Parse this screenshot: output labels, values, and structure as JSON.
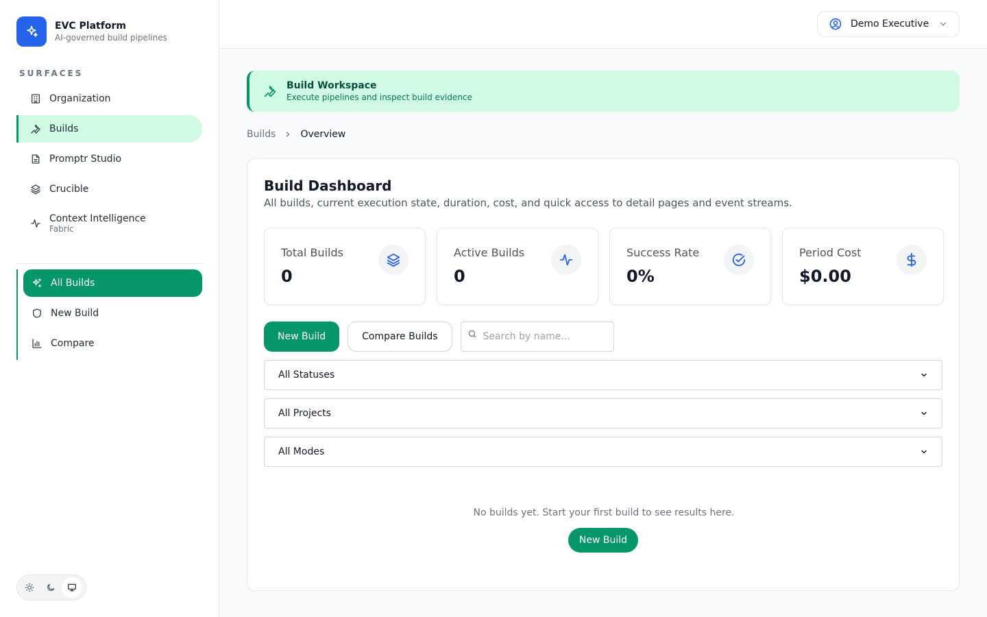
{
  "brand": {
    "title": "EVC Platform",
    "subtitle": "AI-governed build pipelines",
    "color": "#2563eb"
  },
  "sidebar": {
    "section_label": "SURFACES",
    "items": [
      {
        "label": "Organization",
        "icon": "building-icon"
      },
      {
        "label": "Builds",
        "icon": "wrench-icon",
        "active": true
      },
      {
        "label": "Promptr Studio",
        "icon": "document-icon"
      },
      {
        "label": "Crucible",
        "icon": "layers-icon"
      },
      {
        "label": "Context Intelligence",
        "sublabel": "Fabric",
        "icon": "activity-icon"
      }
    ],
    "subitems": [
      {
        "label": "All Builds",
        "icon": "sparkles-icon",
        "active": true
      },
      {
        "label": "New Build",
        "icon": "shield-icon"
      },
      {
        "label": "Compare",
        "icon": "bar-chart-icon"
      }
    ],
    "theme_options": [
      "sun-icon",
      "moon-icon",
      "monitor-icon"
    ]
  },
  "header": {
    "user_label": "Demo Executive"
  },
  "banner": {
    "title": "Build Workspace",
    "subtitle": "Execute pipelines and inspect build evidence",
    "color": "#d1fae5"
  },
  "breadcrumb": {
    "parent": "Builds",
    "current": "Overview"
  },
  "dashboard": {
    "title": "Build Dashboard",
    "description": "All builds, current execution state, duration, cost, and quick access to detail pages and event streams.",
    "stats": [
      {
        "label": "Total Builds",
        "value": "0",
        "icon": "layers-icon"
      },
      {
        "label": "Active Builds",
        "value": "0",
        "icon": "activity-icon"
      },
      {
        "label": "Success Rate",
        "value": "0%",
        "icon": "check-circle-icon"
      },
      {
        "label": "Period Cost",
        "value": "$0.00",
        "icon": "dollar-icon"
      }
    ],
    "new_build_label": "New Build",
    "compare_label": "Compare Builds",
    "search_placeholder": "Search by name...",
    "filters": {
      "status": "All Statuses",
      "project": "All Projects",
      "mode": "All Modes"
    },
    "empty_text": "No builds yet. Start your first build to see results here.",
    "empty_button": "New Build",
    "accent": "#059669"
  }
}
